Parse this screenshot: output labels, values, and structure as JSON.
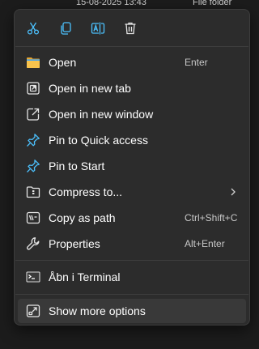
{
  "background": {
    "date": "15-08-2025 13:43",
    "type": "File folder"
  },
  "toolbar": {
    "icons": [
      "scissors-icon",
      "copy-icon",
      "rename-icon",
      "trash-icon"
    ],
    "accent": "#4cc2ff"
  },
  "menu": {
    "open": {
      "label": "Open",
      "shortcut": "Enter"
    },
    "open_new_tab": {
      "label": "Open in new tab"
    },
    "open_new_window": {
      "label": "Open in new window"
    },
    "pin_quick_access": {
      "label": "Pin to Quick access"
    },
    "pin_start": {
      "label": "Pin to Start"
    },
    "compress": {
      "label": "Compress to..."
    },
    "copy_path": {
      "label": "Copy as path",
      "shortcut": "Ctrl+Shift+C"
    },
    "properties": {
      "label": "Properties",
      "shortcut": "Alt+Enter"
    },
    "terminal": {
      "label": "Åbn i Terminal"
    },
    "show_more": {
      "label": "Show more options"
    }
  }
}
